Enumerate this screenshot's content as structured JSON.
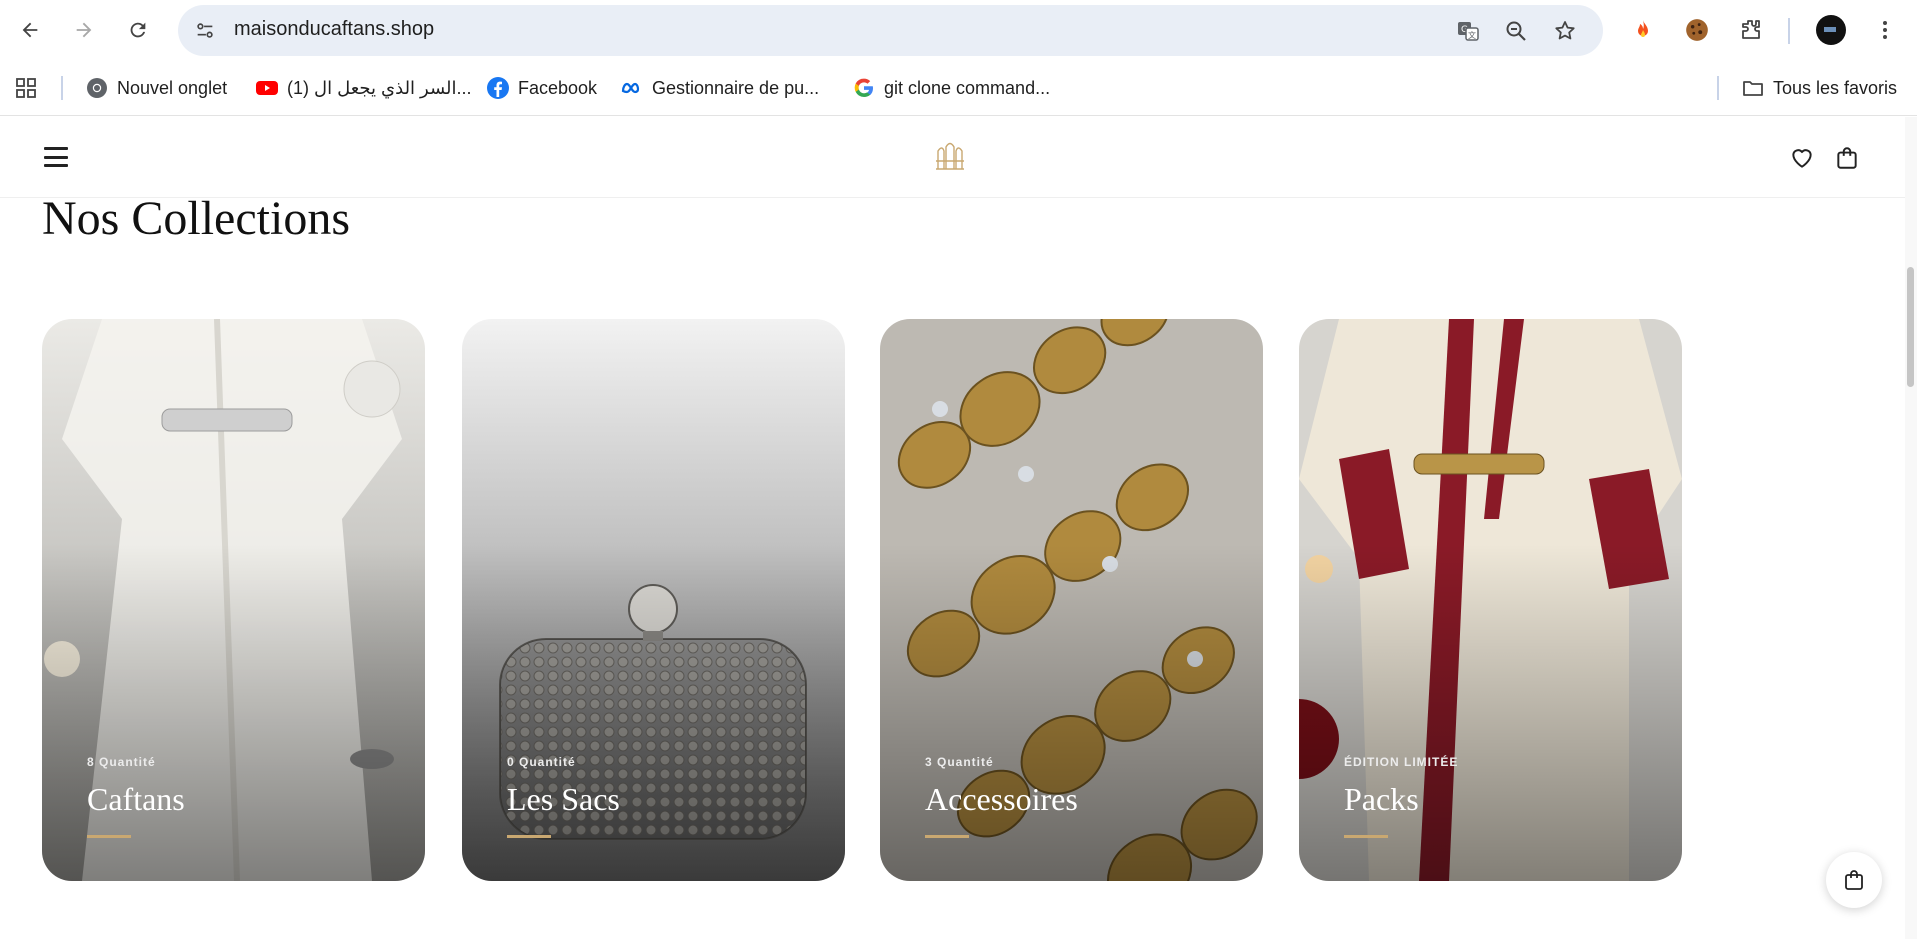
{
  "browser": {
    "url": "maisonducaftans.shop",
    "bookmarks": [
      {
        "label": "Nouvel onglet",
        "icon": "chrome-icon"
      },
      {
        "label": "(1) السر الذي يجعل ال...",
        "icon": "youtube-icon"
      },
      {
        "label": "Facebook",
        "icon": "facebook-icon"
      },
      {
        "label": "Gestionnaire de pu...",
        "icon": "meta-icon"
      },
      {
        "label": "git clone command...",
        "icon": "google-icon"
      }
    ],
    "all_bookmarks_label": "Tous les favoris"
  },
  "site": {
    "section_title": "Nos Collections",
    "accent_color": "#c9a871",
    "collections": [
      {
        "count": "8 Quantité",
        "name": "Caftans"
      },
      {
        "count": "0 Quantité",
        "name": "Les Sacs"
      },
      {
        "count": "3 Quantité",
        "name": "Accessoires"
      },
      {
        "count": "ÉDITION LIMITÉE",
        "name": "Packs"
      }
    ]
  }
}
